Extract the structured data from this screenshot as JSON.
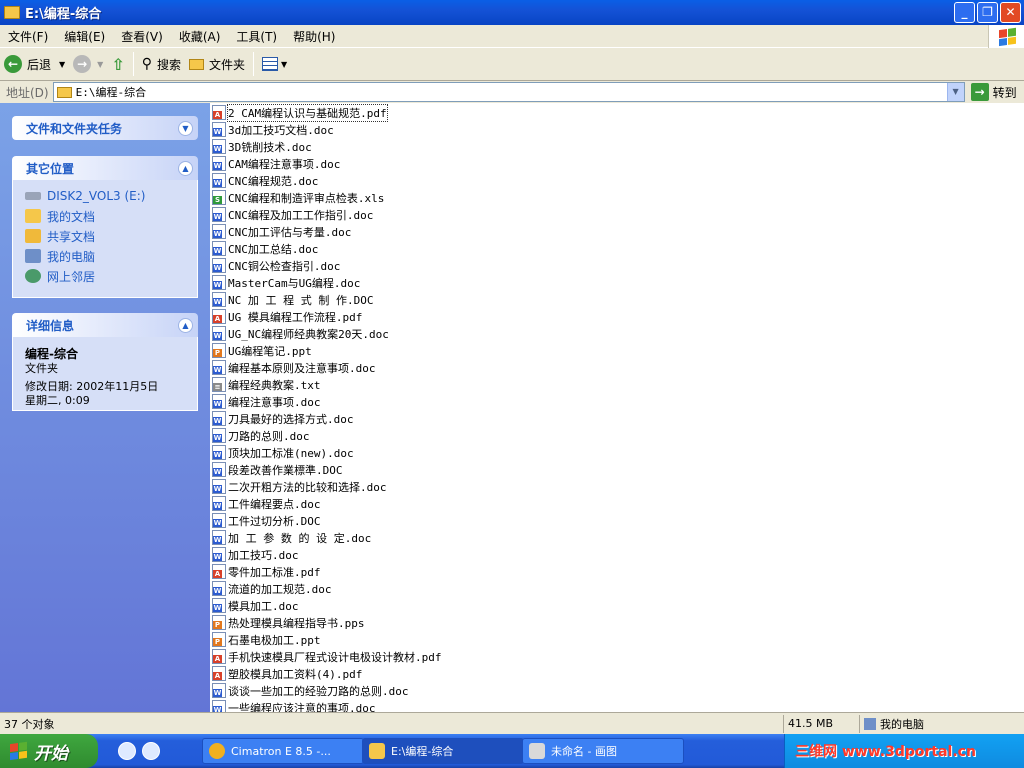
{
  "window": {
    "title": "E:\\编程-综合"
  },
  "menu": [
    "文件(F)",
    "编辑(E)",
    "查看(V)",
    "收藏(A)",
    "工具(T)",
    "帮助(H)"
  ],
  "toolbar": {
    "back": "后退",
    "search": "搜索",
    "folders": "文件夹"
  },
  "address": {
    "label": "地址(D)",
    "value": "E:\\编程-综合",
    "go": "转到"
  },
  "sidebar": {
    "tasks_title": "文件和文件夹任务",
    "places_title": "其它位置",
    "places": [
      "DISK2_VOL3 (E:)",
      "我的文档",
      "共享文档",
      "我的电脑",
      "网上邻居"
    ],
    "details_title": "详细信息",
    "details_name": "编程-综合",
    "details_type": "文件夹",
    "details_modified": "修改日期: 2002年11月5日",
    "details_time": "星期二, 0:09"
  },
  "files": [
    {
      "name": "2 CAM编程认识与基础规范.pdf",
      "type": "pdf"
    },
    {
      "name": "3d加工技巧文档.doc",
      "type": "doc"
    },
    {
      "name": "3D铣削技术.doc",
      "type": "doc"
    },
    {
      "name": "CAM编程注意事项.doc",
      "type": "doc"
    },
    {
      "name": "CNC编程规范.doc",
      "type": "doc"
    },
    {
      "name": "CNC编程和制造评审点检表.xls",
      "type": "xls"
    },
    {
      "name": "CNC编程及加工工作指引.doc",
      "type": "doc"
    },
    {
      "name": "CNC加工评估与考量.doc",
      "type": "doc"
    },
    {
      "name": "CNC加工总结.doc",
      "type": "doc"
    },
    {
      "name": "CNC铜公检查指引.doc",
      "type": "doc"
    },
    {
      "name": "MasterCam与UG编程.doc",
      "type": "doc"
    },
    {
      "name": "NC 加 工 程 式 制 作.DOC",
      "type": "doc"
    },
    {
      "name": "UG 模具编程工作流程.pdf",
      "type": "pdf"
    },
    {
      "name": "UG_NC编程师经典教案20天.doc",
      "type": "doc"
    },
    {
      "name": "UG编程笔记.ppt",
      "type": "ppt"
    },
    {
      "name": "编程基本原则及注意事项.doc",
      "type": "doc"
    },
    {
      "name": "编程经典教案.txt",
      "type": "txt"
    },
    {
      "name": "编程注意事项.doc",
      "type": "doc"
    },
    {
      "name": "刀具最好的选择方式.doc",
      "type": "doc"
    },
    {
      "name": "刀路的总则.doc",
      "type": "doc"
    },
    {
      "name": "顶块加工标准(new).doc",
      "type": "doc"
    },
    {
      "name": "段差改善作業標準.DOC",
      "type": "doc"
    },
    {
      "name": "二次开粗方法的比较和选择.doc",
      "type": "doc"
    },
    {
      "name": "工件编程要点.doc",
      "type": "doc"
    },
    {
      "name": "工件过切分析.DOC",
      "type": "doc"
    },
    {
      "name": "加 工 参 数 的 设 定.doc",
      "type": "doc"
    },
    {
      "name": "加工技巧.doc",
      "type": "doc"
    },
    {
      "name": "零件加工标准.pdf",
      "type": "pdf"
    },
    {
      "name": "流道的加工规范.doc",
      "type": "doc"
    },
    {
      "name": "模具加工.doc",
      "type": "doc"
    },
    {
      "name": "热处理模具编程指导书.pps",
      "type": "ppt"
    },
    {
      "name": "石墨电极加工.ppt",
      "type": "ppt"
    },
    {
      "name": "手机快速模具厂程式设计电极设计教材.pdf",
      "type": "pdf"
    },
    {
      "name": "塑胶模具加工资料(4).pdf",
      "type": "pdf"
    },
    {
      "name": "谈谈一些加工的经验刀路的总则.doc",
      "type": "doc"
    },
    {
      "name": "一些编程应该注意的事项.doc",
      "type": "doc"
    }
  ],
  "status": {
    "count": "37 个对象",
    "size": "41.5 MB",
    "location": "我的电脑"
  },
  "taskbar": {
    "start": "开始",
    "tasks": [
      "Cimatron E 8.5 -...",
      "E:\\编程-综合",
      "未命名 - 画图"
    ],
    "watermark": "三维网 www.3dportal.cn"
  },
  "colors": {
    "title": "#0a5fe6",
    "sidebar": "#6375d6",
    "link": "#215dc6",
    "doc": "#2c5bd0",
    "pdf": "#d8402a",
    "xls": "#2f9a3a",
    "ppt": "#e2781e",
    "txt": "#8a8a8a"
  }
}
